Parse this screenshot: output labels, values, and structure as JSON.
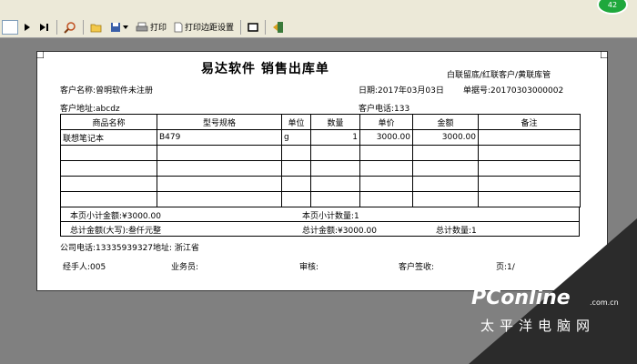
{
  "toolbar": {
    "print_label": "打印",
    "margin_label": "打印边距设置"
  },
  "notification_count": "42",
  "doc": {
    "title": "易达软件  销售出库单",
    "copy_note": "白联留底/红联客户/黄联库管",
    "customer_name": "客户名称:曾明软件未注册",
    "date": "日期:2017年03月03日",
    "doc_no": "单据号:20170303000002",
    "customer_address": "客户地址:abcdz",
    "customer_phone": "客户电话:133",
    "headers": [
      "商品名称",
      "型号规格",
      "单位",
      "数量",
      "单价",
      "金额",
      "备注"
    ],
    "rows": [
      [
        "联想笔记本",
        "B479",
        "g",
        "1",
        "3000.00",
        "3000.00",
        ""
      ],
      [
        "",
        "",
        "",
        "",
        "",
        "",
        ""
      ],
      [
        "",
        "",
        "",
        "",
        "",
        "",
        ""
      ],
      [
        "",
        "",
        "",
        "",
        "",
        "",
        ""
      ],
      [
        "",
        "",
        "",
        "",
        "",
        "",
        ""
      ]
    ],
    "page_subtotal_amount": "本页小计金额:¥3000.00",
    "page_subtotal_qty": "本页小计数量:1",
    "total_amount_upper": "总计金额(大写):叁仟元整",
    "total_amount": "总计金额:¥3000.00",
    "total_qty": "总计数量:1",
    "company_phone": "公司电话:13335939327地址: 浙江省",
    "handler": "经手人:005",
    "salesman": "业务员:",
    "auditor": "审核:",
    "customer_sign": "客户签收:",
    "page": "页:1/"
  },
  "watermark": {
    "brand": "PConline",
    "domain": ".com.cn",
    "subtitle": "太平洋电脑网"
  },
  "colors": {
    "chrome": "#ece9d8",
    "background": "#808080",
    "badge": "#1fa83c"
  }
}
